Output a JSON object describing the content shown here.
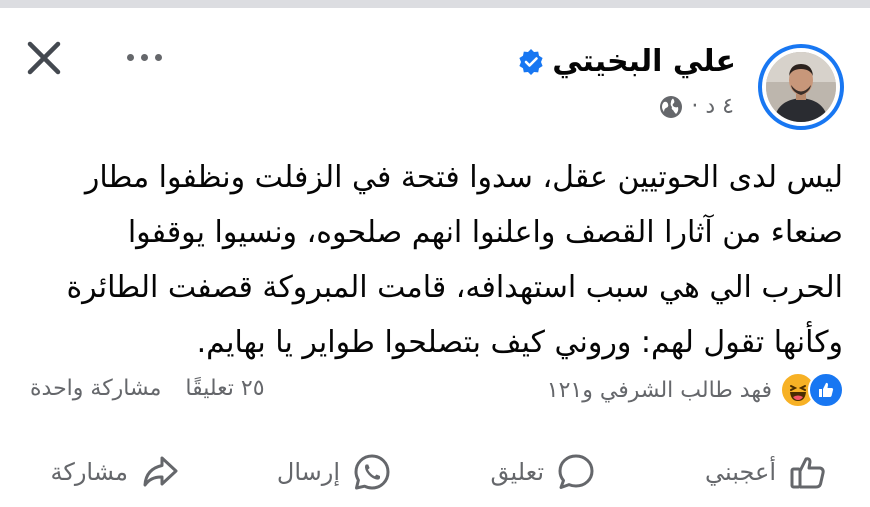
{
  "post": {
    "author": "علي البخيتي",
    "time": "٤ د ·",
    "text": "ليس لدى الحوتيين عقل، سدوا فتحة في الزفلت ونظفوا مطار صنعاء من آثارا القصف واعلنوا انهم صلحوه، ونسيوا يوقفوا الحرب الي هي سبب استهدافه، قامت المبروكة قصفت الطائرة وكأنها تقول لهم: وروني كيف بتصلحوا طواير يا بهايم."
  },
  "stats": {
    "reactors": "فهد طالب الشرفي و١٢١",
    "comments": "٢٥ تعليقًا",
    "shares": "مشاركة واحدة"
  },
  "actions": {
    "like": "أعجبني",
    "comment": "تعليق",
    "send": "إرسال",
    "share": "مشاركة"
  },
  "icons": [
    "close-icon",
    "more-icon",
    "verified-badge-icon",
    "globe-icon",
    "like-reaction-icon",
    "haha-reaction-icon",
    "like-icon",
    "comment-icon",
    "whatsapp-icon",
    "share-icon"
  ],
  "colors": {
    "brand": "#1877f2",
    "secondary_text": "#65676b",
    "text": "#050505",
    "haha": "#f7b125"
  }
}
